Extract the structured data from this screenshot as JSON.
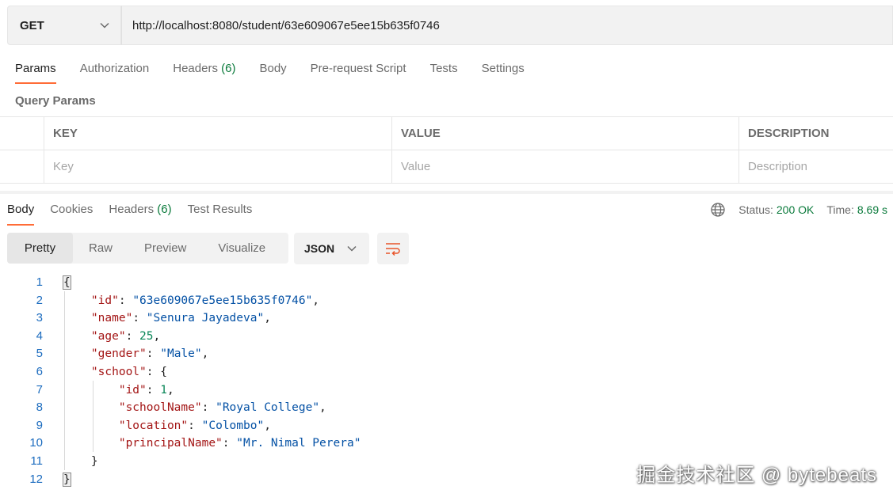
{
  "request": {
    "method": "GET",
    "url": "http://localhost:8080/student/63e609067e5ee15b635f0746"
  },
  "request_tabs": [
    {
      "label": "Params",
      "count": ""
    },
    {
      "label": "Authorization",
      "count": ""
    },
    {
      "label": "Headers",
      "count": "(6)"
    },
    {
      "label": "Body",
      "count": ""
    },
    {
      "label": "Pre-request Script",
      "count": ""
    },
    {
      "label": "Tests",
      "count": ""
    },
    {
      "label": "Settings",
      "count": ""
    }
  ],
  "query_params": {
    "title": "Query Params",
    "columns": [
      "KEY",
      "VALUE",
      "DESCRIPTION"
    ],
    "placeholders": [
      "Key",
      "Value",
      "Description"
    ]
  },
  "response_tabs": [
    {
      "label": "Body",
      "count": ""
    },
    {
      "label": "Cookies",
      "count": ""
    },
    {
      "label": "Headers",
      "count": "(6)"
    },
    {
      "label": "Test Results",
      "count": ""
    }
  ],
  "response_status": {
    "status_label": "Status:",
    "status_value": "200 OK",
    "time_label": "Time:",
    "time_value": "8.69 s"
  },
  "view_modes": [
    "Pretty",
    "Raw",
    "Preview",
    "Visualize"
  ],
  "format": "JSON",
  "line_numbers": [
    "1",
    "2",
    "3",
    "4",
    "5",
    "6",
    "7",
    "8",
    "9",
    "10",
    "11",
    "12"
  ],
  "response_body": {
    "id": "63e609067e5ee15b635f0746",
    "name": "Senura Jayadeva",
    "age": "25",
    "gender": "Male",
    "school": {
      "id": "1",
      "schoolName": "Royal College",
      "location": "Colombo",
      "principalName": "Mr. Nimal Perera"
    }
  },
  "watermark": "掘金技术社区 @ bytebeats",
  "colors": {
    "accent": "#ff6c37",
    "status_green": "#0a7a3b",
    "json_key": "#a31515",
    "json_string": "#0451a5",
    "json_number": "#098658",
    "line_number": "#1c6cbf"
  }
}
